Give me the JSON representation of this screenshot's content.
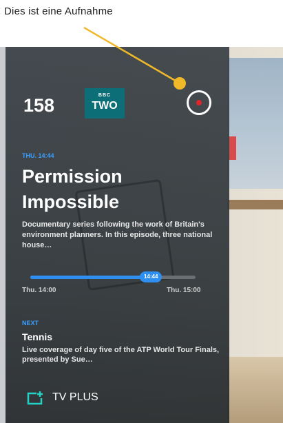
{
  "annotation": {
    "text": "Dies ist eine Aufnahme"
  },
  "channel": {
    "number": "158",
    "logo_top": "BBC",
    "logo_main": "TWO"
  },
  "current": {
    "time_tag": "THU. 14:44",
    "title": "Permission Impossible",
    "description": "Documentary series following the work of Britain's environment planners. In this episode, three national house…",
    "start": "Thu. 14:00",
    "end": "Thu. 15:00",
    "now": "14:44",
    "progress": 0.73
  },
  "next": {
    "label": "NEXT",
    "title": "Tennis",
    "description": "Live coverage of day five of the ATP World Tour Finals, presented by Sue…"
  },
  "brand": {
    "name": "TV PLUS"
  },
  "colors": {
    "accent": "#2f8ff0",
    "record": "#e0262a",
    "pointer": "#f0b92a"
  }
}
